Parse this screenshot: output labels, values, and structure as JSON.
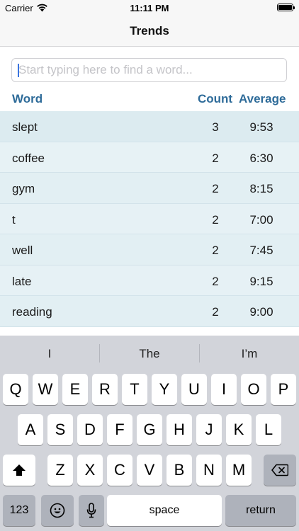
{
  "status_bar": {
    "carrier": "Carrier",
    "time": "11:11 PM",
    "icons": [
      "wifi-icon",
      "battery-icon"
    ]
  },
  "nav": {
    "title": "Trends"
  },
  "search": {
    "placeholder": "Start typing here to find a word...",
    "value": ""
  },
  "table": {
    "headers": {
      "word": "Word",
      "count": "Count",
      "average": "Average"
    },
    "rows": [
      {
        "word": "slept",
        "count": "3",
        "average": "9:53"
      },
      {
        "word": "coffee",
        "count": "2",
        "average": "6:30"
      },
      {
        "word": "gym",
        "count": "2",
        "average": "8:15"
      },
      {
        "word": "t",
        "count": "2",
        "average": "7:00"
      },
      {
        "word": "well",
        "count": "2",
        "average": "7:45"
      },
      {
        "word": "late",
        "count": "2",
        "average": "9:15"
      },
      {
        "word": "reading",
        "count": "2",
        "average": "9:00"
      }
    ]
  },
  "keyboard": {
    "suggestions": [
      "I",
      "The",
      "I’m"
    ],
    "row1": [
      "Q",
      "W",
      "E",
      "R",
      "T",
      "Y",
      "U",
      "I",
      "O",
      "P"
    ],
    "row2": [
      "A",
      "S",
      "D",
      "F",
      "G",
      "H",
      "J",
      "K",
      "L"
    ],
    "row3": [
      "Z",
      "X",
      "C",
      "V",
      "B",
      "N",
      "M"
    ],
    "numbers_label": "123",
    "space_label": "space",
    "return_label": "return",
    "icons": [
      "shift-icon",
      "backspace-icon",
      "emoji-icon",
      "microphone-icon"
    ]
  },
  "colors": {
    "header_text": "#2e6b99",
    "row_background": "#e6f1f5",
    "row_divider": "#d3e3ea",
    "keyboard_background": "#d2d4da"
  }
}
